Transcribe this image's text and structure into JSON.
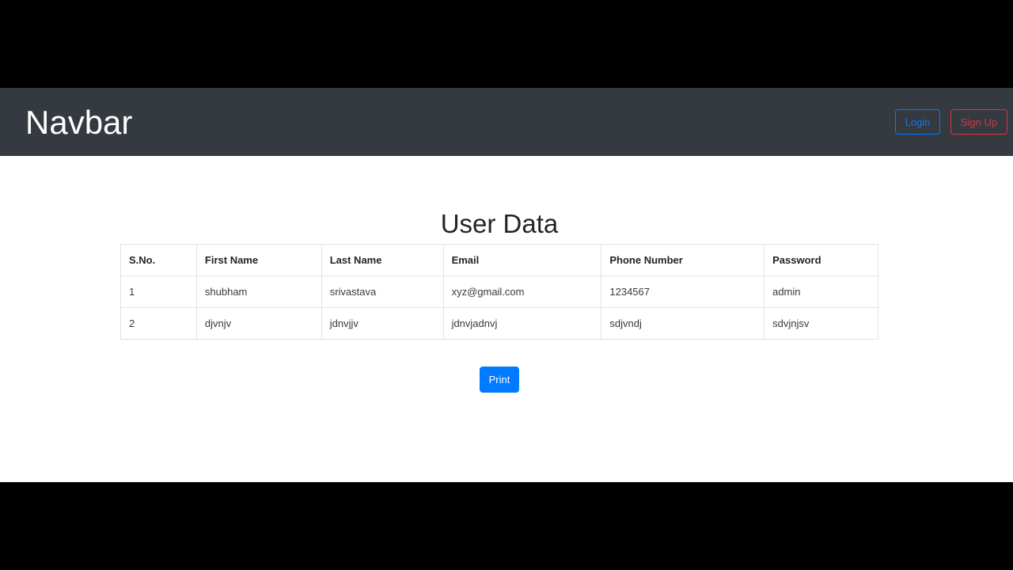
{
  "navbar": {
    "brand": "Navbar",
    "login_label": "Login",
    "signup_label": "Sign Up"
  },
  "main": {
    "title": "User Data",
    "table": {
      "headers": [
        "S.No.",
        "First Name",
        "Last Name",
        "Email",
        "Phone Number",
        "Password"
      ],
      "rows": [
        [
          "1",
          "shubham",
          "srivastava",
          "xyz@gmail.com",
          "1234567",
          "admin"
        ],
        [
          "2",
          "djvnjv",
          "jdnvjjv",
          "jdnvjadnvj",
          "sdjvndj",
          "sdvjnjsv"
        ]
      ]
    },
    "print_label": "Print"
  },
  "colors": {
    "navbar_bg": "#343a40",
    "primary": "#007bff",
    "danger": "#dc3545",
    "letterbox": "#000000"
  }
}
